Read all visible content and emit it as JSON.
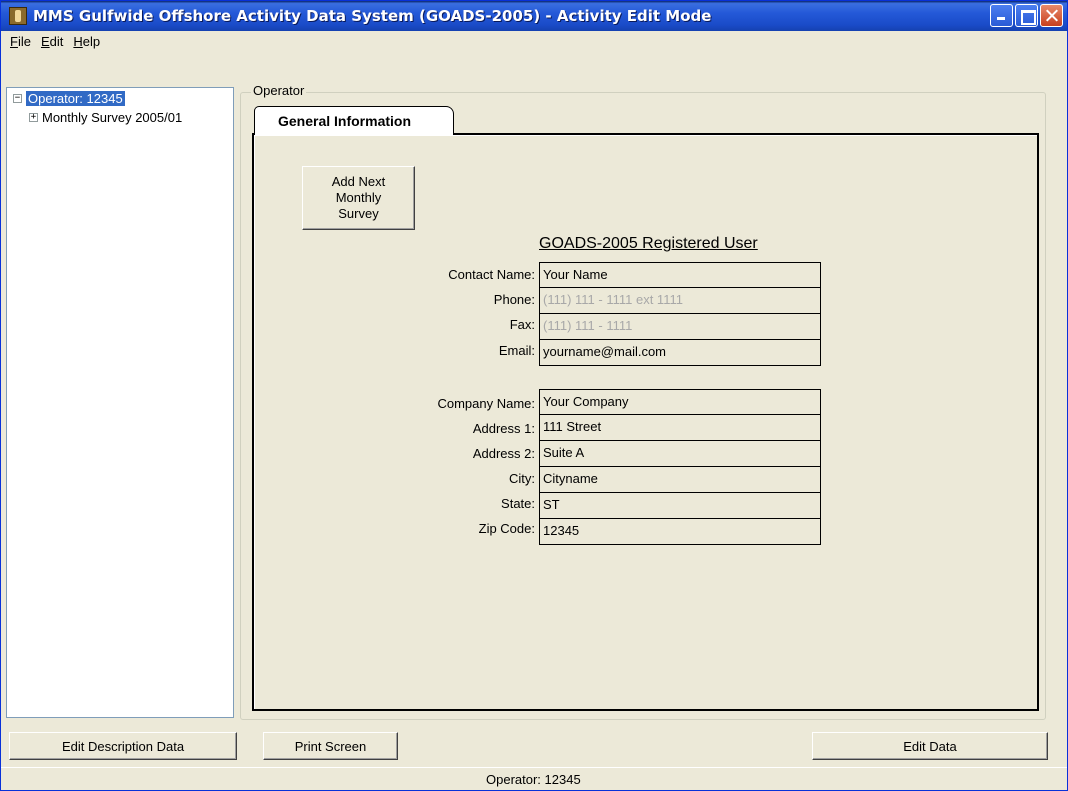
{
  "window": {
    "title": "MMS Gulfwide Offshore Activity Data System (GOADS-2005) - Activity Edit Mode"
  },
  "menu": {
    "file": {
      "first": "F",
      "rest": "ile"
    },
    "edit": {
      "first": "E",
      "rest": "dit"
    },
    "help": {
      "first": "H",
      "rest": "elp"
    }
  },
  "tree": {
    "root": {
      "label": "Operator: 12345",
      "expander": "−"
    },
    "child": {
      "label": "Monthly Survey 2005/01",
      "expander": "+"
    }
  },
  "operator_group": {
    "label": "Operator",
    "tab_label": "General Information",
    "add_button_label": "Add Next\nMonthly\nSurvey",
    "form_title": "GOADS-2005 Registered User",
    "contact": {
      "contact_name": {
        "label": "Contact Name:",
        "value": "Your Name"
      },
      "phone": {
        "label": "Phone:",
        "value": "(111) 111 - 1111 ext 1111"
      },
      "fax": {
        "label": "Fax:",
        "value": "(111) 111 - 1111"
      },
      "email": {
        "label": "Email:",
        "value": "yourname@mail.com"
      }
    },
    "company": {
      "company_name": {
        "label": "Company Name:",
        "value": "Your Company"
      },
      "address1": {
        "label": "Address 1:",
        "value": "111 Street"
      },
      "address2": {
        "label": "Address 2:",
        "value": "Suite A"
      },
      "city": {
        "label": "City:",
        "value": "Cityname"
      },
      "state": {
        "label": "State:",
        "value": "ST"
      },
      "zip": {
        "label": "Zip Code:",
        "value": "12345"
      }
    }
  },
  "bottom_buttons": {
    "edit_description": "Edit Description Data",
    "print_screen": "Print Screen",
    "edit_data": "Edit Data"
  },
  "status": {
    "text": "Operator: 12345"
  }
}
